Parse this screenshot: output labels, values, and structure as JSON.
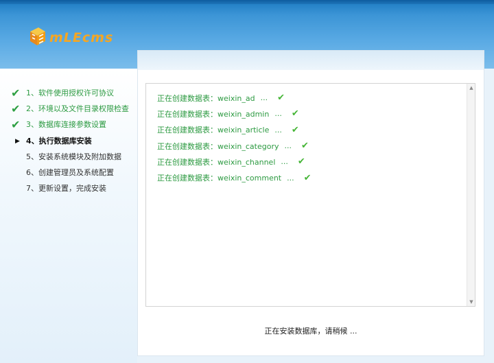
{
  "header": {
    "logo_text": "MLECMS"
  },
  "steps": [
    {
      "label": "1、软件使用授权许可协议",
      "state": "done"
    },
    {
      "label": "2、环境以及文件目录权限检查",
      "state": "done"
    },
    {
      "label": "3、数据库连接参数设置",
      "state": "done"
    },
    {
      "label": "4、执行数据库安装",
      "state": "current"
    },
    {
      "label": "5、安装系统模块及附加数据",
      "state": "pending"
    },
    {
      "label": "6、创建管理员及系统配置",
      "state": "pending"
    },
    {
      "label": "7、更新设置，完成安装",
      "state": "pending"
    }
  ],
  "log": {
    "lines": [
      {
        "text": "正在创建数据表：weixin_ad",
        "dots": "...",
        "status_icon": "check-icon"
      },
      {
        "text": "正在创建数据表：weixin_admin",
        "dots": "...",
        "status_icon": "check-icon"
      },
      {
        "text": "正在创建数据表：weixin_article",
        "dots": "...",
        "status_icon": "check-icon"
      },
      {
        "text": "正在创建数据表：weixin_category",
        "dots": "...",
        "status_icon": "check-icon"
      },
      {
        "text": "正在创建数据表：weixin_channel",
        "dots": "...",
        "status_icon": "check-icon"
      },
      {
        "text": "正在创建数据表：weixin_comment",
        "dots": "...",
        "status_icon": "check-icon"
      }
    ]
  },
  "status_text": "正在安装数据库，请稍候 ...",
  "icons": {
    "done": "✔",
    "current": "▶",
    "ok": "✔",
    "scroll_up": "▲",
    "scroll_down": "▼"
  },
  "colors": {
    "header_blue": "#3c95d6",
    "done_green": "#2c9a41",
    "logo_orange": "#f39c12"
  }
}
